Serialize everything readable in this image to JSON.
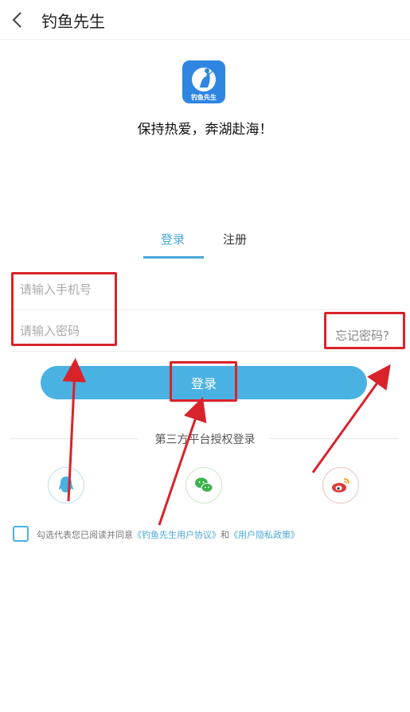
{
  "header": {
    "title": "钓鱼先生",
    "back_icon": "chevron-left-icon"
  },
  "logo": {
    "text": "钓鱼先生",
    "color": "#2f86e0"
  },
  "slogan": "保持热爱，奔湖赴海！",
  "tabs": [
    {
      "label": "登录",
      "active": true
    },
    {
      "label": "注册",
      "active": false
    }
  ],
  "form": {
    "phone_placeholder": "请输入手机号",
    "password_placeholder": "请输入密码",
    "forgot_label": "忘记密码?",
    "login_label": "登录"
  },
  "third_party": {
    "title": "第三方平台授权登录",
    "providers": [
      {
        "name": "qq",
        "icon": "qq-icon",
        "color": "#4ab1e3"
      },
      {
        "name": "wechat",
        "icon": "wechat-icon",
        "color": "#3bb34a"
      },
      {
        "name": "weibo",
        "icon": "weibo-icon",
        "color": "#e03a3a"
      }
    ]
  },
  "agreement": {
    "prefix": "勾选代表您已阅读并同意",
    "link1": "《钓鱼先生用户协议》",
    "middle": "和",
    "link2": "《用户隐私政策》",
    "checked": false
  },
  "colors": {
    "accent": "#4ab1e3",
    "annotation": "#d9232b"
  }
}
